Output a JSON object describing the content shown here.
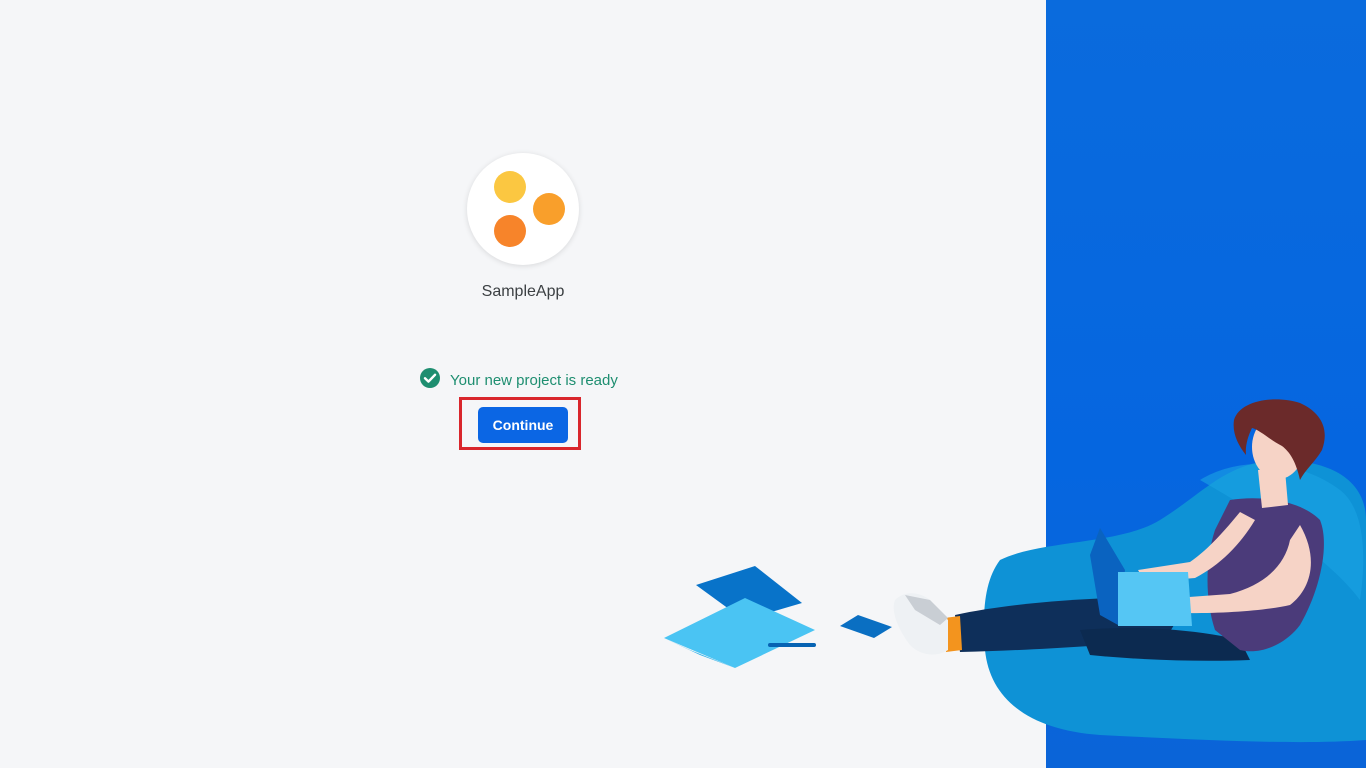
{
  "app": {
    "name": "SampleApp",
    "logo_colors": [
      "#fbc741",
      "#f99f2b",
      "#f7842a"
    ]
  },
  "status": {
    "text": "Your new project is ready",
    "icon": "check-circle-icon",
    "color": "#1e8e70"
  },
  "actions": {
    "continue_label": "Continue"
  },
  "theme": {
    "accent": "#0b66e4",
    "highlight": "#d9262c"
  },
  "illustration": {
    "subject": "person-with-laptop-on-beanbag"
  }
}
